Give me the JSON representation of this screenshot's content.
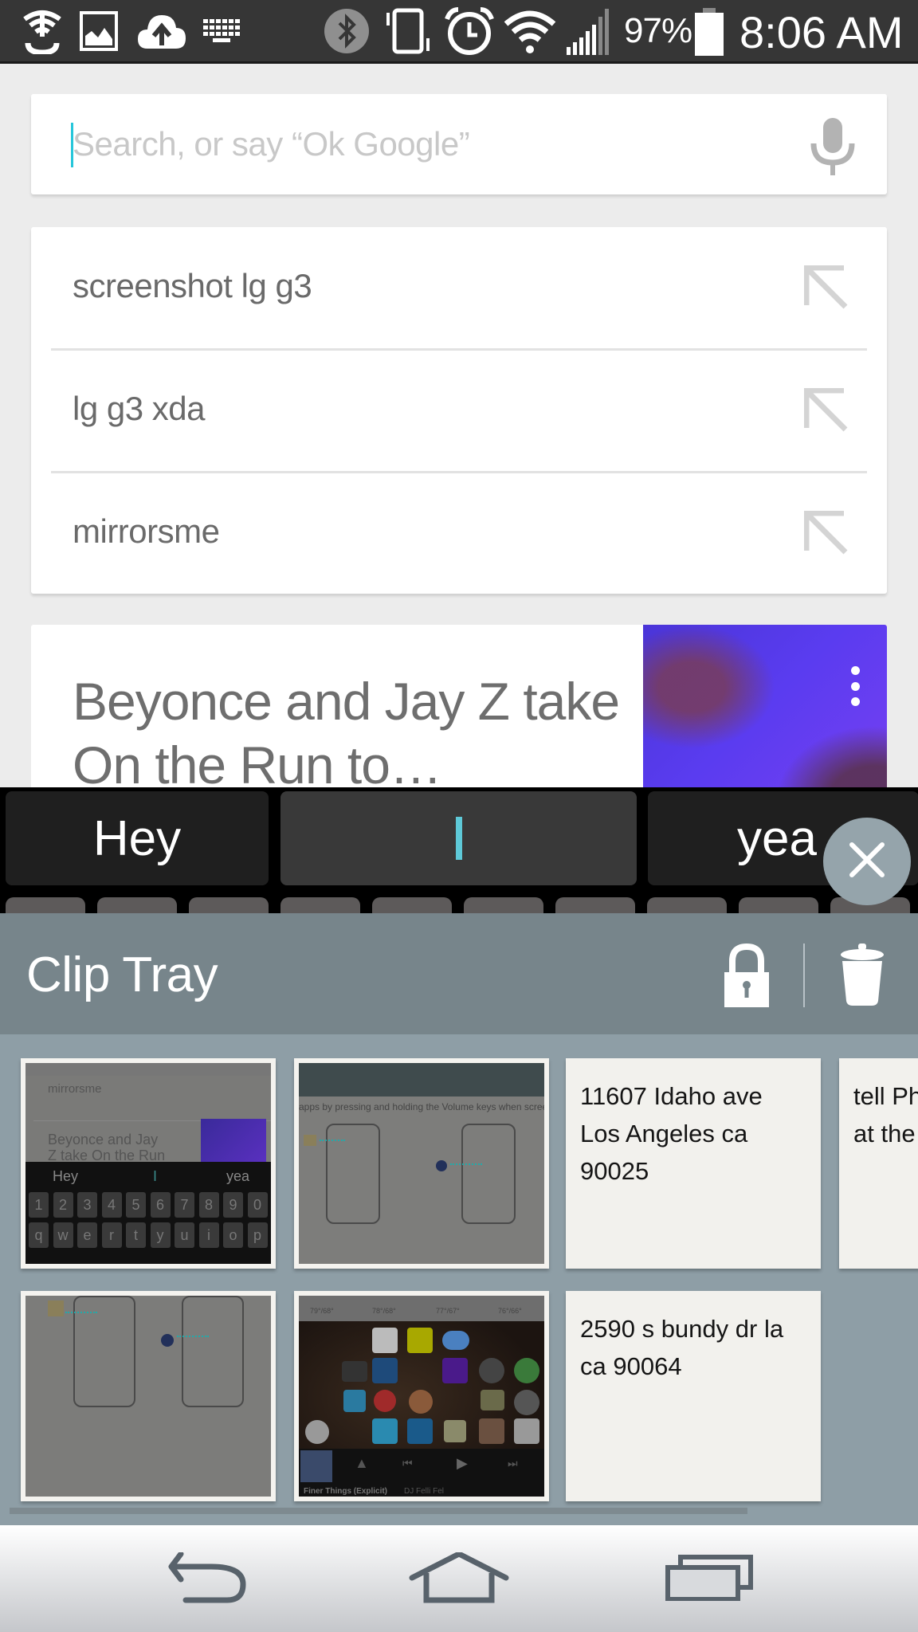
{
  "status_bar": {
    "left_icons": [
      "usb-tether-icon",
      "gallery-icon",
      "cloud-upload-icon",
      "keyboard-icon"
    ],
    "right_icons": [
      "bluetooth-icon",
      "vibrate-icon",
      "alarm-icon",
      "wifi-icon",
      "signal-icon",
      "battery-icon"
    ],
    "battery_percent": "97%",
    "time": "8:06 AM"
  },
  "search": {
    "placeholder": "Search, or say “Ok Google”",
    "value": "",
    "mic_icon": "mic-icon"
  },
  "suggestions": [
    {
      "label": "screenshot lg g3",
      "icon": "arrow-up-left-icon"
    },
    {
      "label": "lg g3 xda",
      "icon": "arrow-up-left-icon"
    },
    {
      "label": "mirrorsme",
      "icon": "arrow-up-left-icon"
    }
  ],
  "news_card": {
    "title": "Beyonce and Jay Z take On the Run to…",
    "menu_icon": "more-vert-icon"
  },
  "keyboard": {
    "candidates": [
      "Hey",
      "I",
      "yea"
    ],
    "close_icon": "close-icon"
  },
  "clip_tray": {
    "title": "Clip Tray",
    "lock_icon": "lock-icon",
    "trash_icon": "trash-icon",
    "clips": [
      {
        "type": "image",
        "description": "Screenshot of Google search with keyboard",
        "mini": {
          "suggestion": "mirrorsme",
          "news": "Beyonce and Jay Z take On the Run to...",
          "candidates": [
            "Hey",
            "I",
            "yea"
          ],
          "number_row": [
            "1",
            "2",
            "3",
            "4",
            "5",
            "6",
            "7",
            "8",
            "9",
            "0"
          ],
          "letter_row": [
            "q",
            "w",
            "e",
            "r",
            "t",
            "y",
            "u",
            "i",
            "o",
            "p"
          ]
        }
      },
      {
        "type": "image",
        "description": "Quick Memo volume key instructions",
        "mini": {
          "caption": "apps by pressing and holding the Volume keys when screen is off or locked."
        }
      },
      {
        "type": "text",
        "text": "11607 Idaho ave\nLos Angeles ca\n90025"
      },
      {
        "type": "text",
        "text": "tell Ph\nat the"
      },
      {
        "type": "image",
        "description": "Volume keys diagram",
        "mini": {}
      },
      {
        "type": "image",
        "description": "Home screen with apps",
        "mini": {
          "temps": [
            "79°/68°",
            "78°/68°",
            "77°/67°",
            "76°/66°"
          ],
          "now_playing": "Finer Things (Explicit)",
          "artist": "DJ Felli Fel"
        }
      },
      {
        "type": "text",
        "text": "2590 s bundy dr la\nca 90064"
      }
    ]
  },
  "nav_bar": {
    "buttons": [
      {
        "name": "back-button",
        "icon": "back-icon"
      },
      {
        "name": "home-button",
        "icon": "home-icon"
      },
      {
        "name": "recents-button",
        "icon": "recents-icon"
      }
    ]
  },
  "colors": {
    "accent_cursor": "#26c6da",
    "clip_header": "#77858b",
    "clip_body": "#8e9ea6",
    "status_bar": "#363636"
  }
}
